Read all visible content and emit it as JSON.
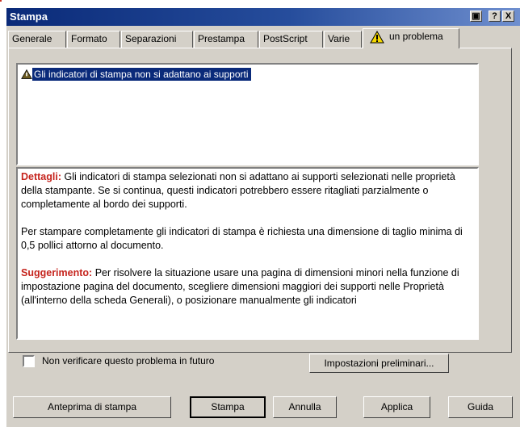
{
  "window": {
    "title": "Stampa",
    "controls": [
      "▣",
      "?",
      "X"
    ]
  },
  "tabs": [
    {
      "label": "Generale"
    },
    {
      "label": "Formato"
    },
    {
      "label": "Separazioni"
    },
    {
      "label": "Prestampa"
    },
    {
      "label": "PostScript"
    },
    {
      "label": "Varie"
    },
    {
      "label": "un problema",
      "icon": "warning-icon",
      "active": true
    }
  ],
  "problems_list": {
    "items": [
      {
        "text": "Gli indicatori di stampa non si adattano ai supporti",
        "icon": "warning-icon",
        "selected": true
      }
    ]
  },
  "details": {
    "details_label": "Dettagli:",
    "details_text": "Gli indicatori di stampa selezionati non si adattano ai supporti selezionati nelle proprietà della stampante. Se si continua, questi indicatori potrebbero essere ritagliati parzialmente o completamente al bordo dei supporti.",
    "paragraph2": "Per stampare completamente gli indicatori di stampa è richiesta una dimensione di taglio minima di 0,5 pollici attorno al documento.",
    "suggestion_label": "Suggerimento:",
    "suggestion_text": "Per risolvere la situazione usare una pagina di dimensioni minori nella funzione di impostazione pagina del documento, scegliere dimensioni maggiori dei supporti nelle Proprietà (all'interno della scheda Generali), o posizionare manualmente gli indicatori"
  },
  "checkbox": {
    "label": "Non verificare questo problema in futuro",
    "checked": false
  },
  "buttons": {
    "preferences": "Impostazioni preliminari...",
    "preview": "Anteprima di stampa",
    "print": "Stampa",
    "cancel": "Annulla",
    "apply": "Applica",
    "help": "Guida"
  },
  "colors": {
    "title_bar": "#0a2a78",
    "highlight": "#c5231c",
    "dialog_bg": "#d4d0c8"
  }
}
